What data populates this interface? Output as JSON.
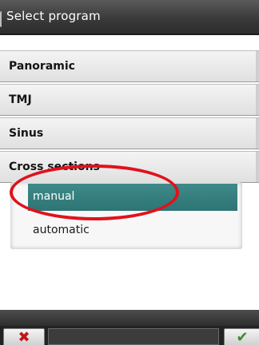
{
  "window": {
    "title": "Select program"
  },
  "menu": {
    "items": [
      {
        "label": "Panoramic"
      },
      {
        "label": "TMJ"
      },
      {
        "label": "Sinus"
      },
      {
        "label": "Cross sections"
      }
    ]
  },
  "submenu": {
    "items": [
      {
        "label": "manual",
        "selected": true
      },
      {
        "label": "automatic",
        "selected": false
      }
    ]
  },
  "footer": {
    "cancel_icon": "close-icon",
    "cancel_glyph": "✖",
    "confirm_icon": "checkmark-icon",
    "confirm_glyph": "✔"
  },
  "colors": {
    "selection": "#2e7474",
    "highlight_annotation": "#e0121c",
    "cancel": "#c11616",
    "confirm": "#3f8a2a"
  }
}
